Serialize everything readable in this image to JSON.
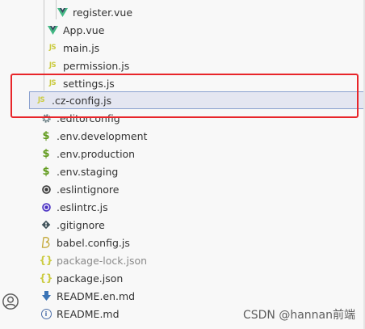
{
  "explorer": {
    "items": [
      {
        "label": "register.vue",
        "icon": "vue-icon"
      },
      {
        "label": "App.vue",
        "icon": "vue-icon"
      },
      {
        "label": "main.js",
        "icon": "js-icon",
        "icon_text": "JS"
      },
      {
        "label": "permission.js",
        "icon": "js-icon",
        "icon_text": "JS"
      },
      {
        "label": "settings.js",
        "icon": "js-icon",
        "icon_text": "JS"
      },
      {
        "label": ".cz-config.js",
        "icon": "js-icon",
        "icon_text": "JS"
      },
      {
        "label": ".editorconfig",
        "icon": "gear-icon"
      },
      {
        "label": ".env.development",
        "icon": "dollar-icon",
        "icon_text": "$"
      },
      {
        "label": ".env.production",
        "icon": "dollar-icon",
        "icon_text": "$"
      },
      {
        "label": ".env.staging",
        "icon": "dollar-icon",
        "icon_text": "$"
      },
      {
        "label": ".eslintignore",
        "icon": "eslint-icon"
      },
      {
        "label": ".eslintrc.js",
        "icon": "eslint-icon"
      },
      {
        "label": ".gitignore",
        "icon": "git-icon"
      },
      {
        "label": "babel.config.js",
        "icon": "babel-icon"
      },
      {
        "label": "package-lock.json",
        "icon": "json-icon",
        "icon_text": "{}"
      },
      {
        "label": "package.json",
        "icon": "json-icon",
        "icon_text": "{}"
      },
      {
        "label": "README.en.md",
        "icon": "download-arrow-icon"
      },
      {
        "label": "README.md",
        "icon": "info-icon",
        "icon_text": "i"
      }
    ],
    "selected": ".cz-config.js"
  },
  "watermark": "CSDN @hannan前端",
  "colors": {
    "highlight_box": "#e8252a",
    "selection": "#e4e6f1",
    "vue_green": "#41b883",
    "js_yellow": "#cbcb41"
  }
}
